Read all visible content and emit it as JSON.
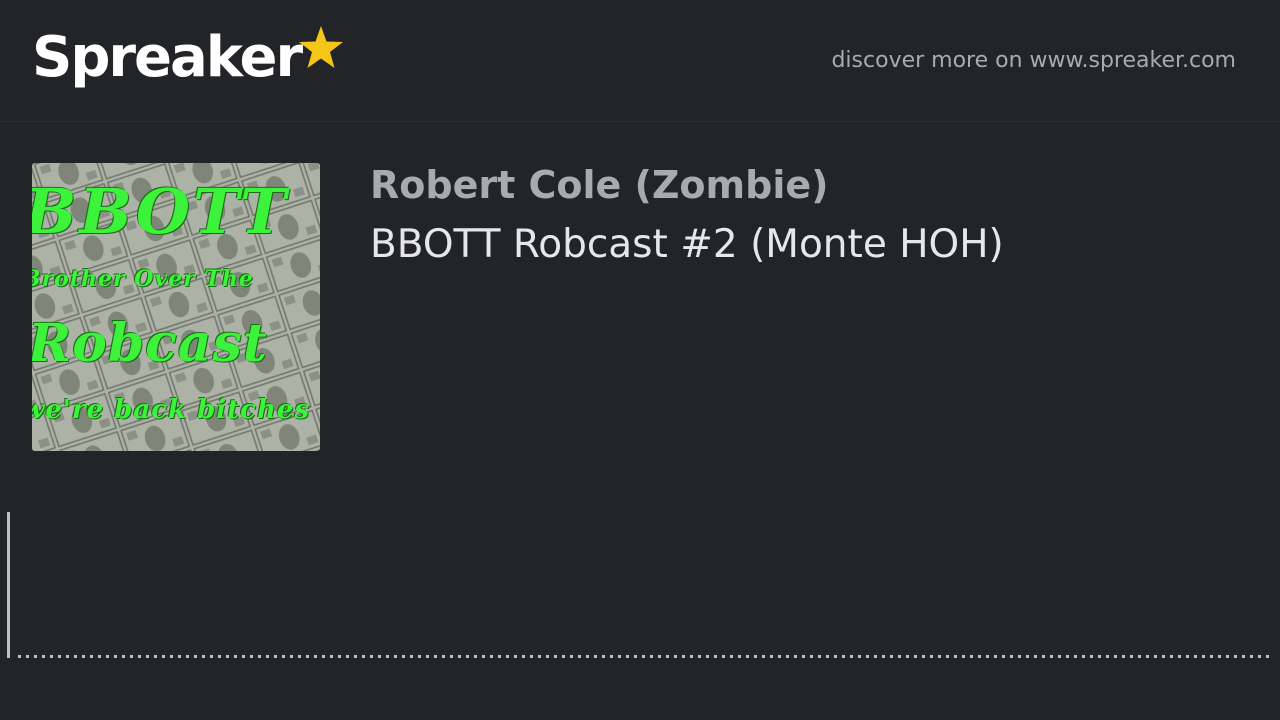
{
  "brand": {
    "name": "Spreaker",
    "star_color": "#f5c518",
    "icon": "star-icon"
  },
  "header": {
    "discover_text": "discover more on www.spreaker.com"
  },
  "episode": {
    "author": "Robert Cole (Zombie)",
    "title": "BBOTT Robcast #2 (Monte HOH)"
  },
  "cover_art": {
    "lines": [
      "BBOTT",
      "Brother Over The",
      "Robcast",
      "we're back bitches"
    ],
    "text_color": "#3df23a"
  },
  "player": {
    "progress_fraction": 0.0,
    "waveform_color": "#bfc0c5"
  },
  "colors": {
    "background": "#232428",
    "text_primary": "#e6e7ea",
    "text_muted": "#a9aab0"
  }
}
